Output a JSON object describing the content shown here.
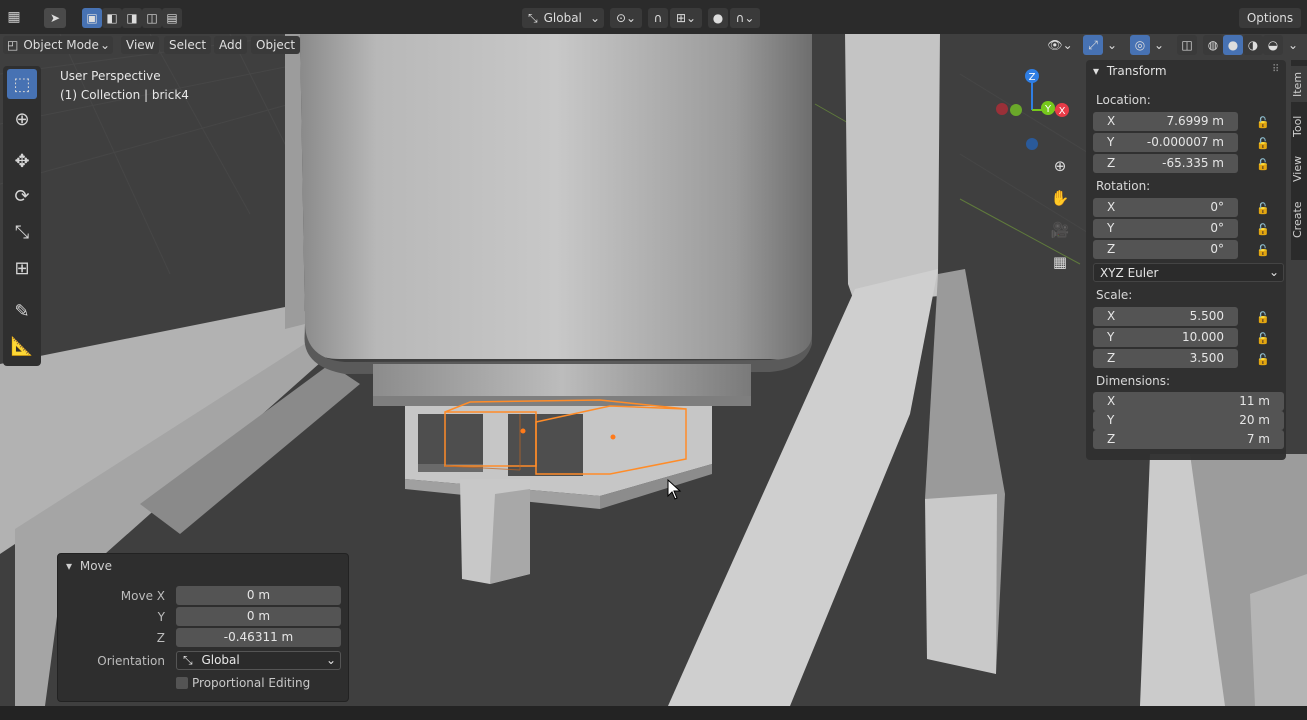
{
  "header": {
    "orientation_label": "Global",
    "options_label": "Options",
    "mode_label": "Object Mode",
    "menus": [
      "View",
      "Select",
      "Add",
      "Object"
    ]
  },
  "viewport": {
    "perspective_label": "User Perspective",
    "collection_label": "(1) Collection | brick4"
  },
  "gizmo": {
    "z": "Z",
    "x": "X",
    "y": "Y"
  },
  "transform": {
    "title": "Transform",
    "location_label": "Location:",
    "location": {
      "x": "7.6999 m",
      "y": "-0.000007 m",
      "z": "-65.335 m"
    },
    "rotation_label": "Rotation:",
    "rotation": {
      "x": "0°",
      "y": "0°",
      "z": "0°"
    },
    "rotation_mode": "XYZ Euler",
    "scale_label": "Scale:",
    "scale": {
      "x": "5.500",
      "y": "10.000",
      "z": "3.500"
    },
    "dimensions_label": "Dimensions:",
    "dimensions": {
      "x": "11 m",
      "y": "20 m",
      "z": "7 m"
    },
    "axis_labels": {
      "x": "X",
      "y": "Y",
      "z": "Z"
    }
  },
  "side_tabs": [
    "Item",
    "Tool",
    "View",
    "Create"
  ],
  "move_panel": {
    "title": "Move",
    "move_x_label": "Move X",
    "move_x": "0 m",
    "y_label": "Y",
    "move_y": "0 m",
    "z_label": "Z",
    "move_z": "-0.46311 m",
    "orientation_label": "Orientation",
    "orientation_value": "Global",
    "proportional_label": "Proportional Editing"
  },
  "colors": {
    "accent": "#4772b3",
    "selection_outline": "#ff8c28",
    "axis_x": "#e83b48",
    "axis_y": "#76c81c",
    "axis_z": "#2f7ee4"
  },
  "icons": [
    "editor-type-icon",
    "select-cursor-icon",
    "select-box-icon",
    "cursor-icon",
    "move-icon",
    "rotate-icon",
    "scale-icon",
    "transform-icon",
    "annotate-icon",
    "measure-icon",
    "zoom-icon",
    "hand-icon",
    "camera-icon",
    "grid-icon",
    "lock-icon"
  ]
}
